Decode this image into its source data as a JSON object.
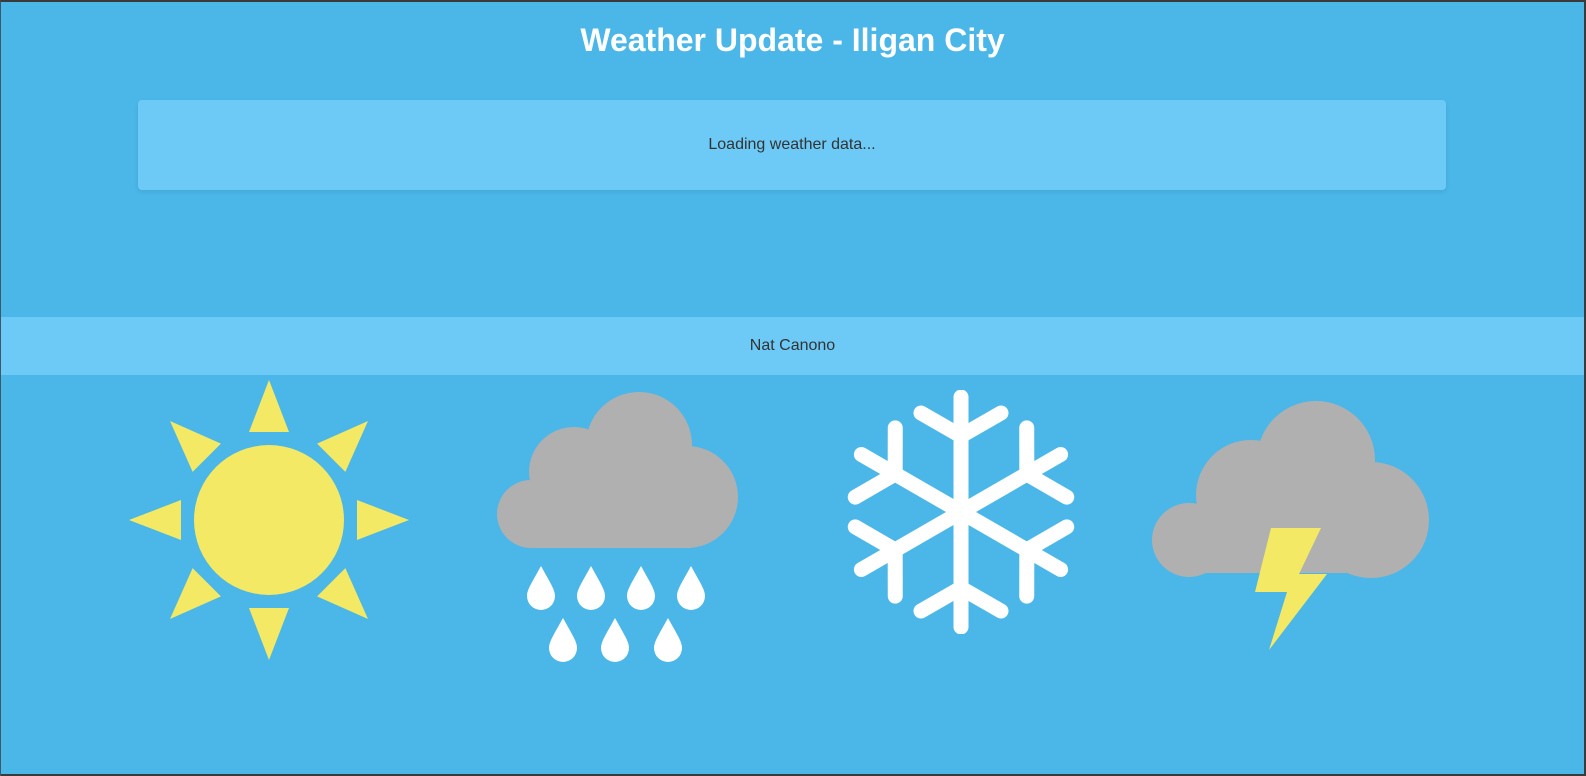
{
  "header": {
    "title": "Weather Update - Iligan City"
  },
  "weather_panel": {
    "status_text": "Loading weather data..."
  },
  "footer": {
    "author": "Nat Canono"
  },
  "icons": [
    "sun-icon",
    "rain-cloud-icon",
    "snowflake-icon",
    "thunderstorm-icon"
  ],
  "colors": {
    "background": "#4bb6e8",
    "panel": "#6dcaf6",
    "sun": "#f3e964",
    "cloud": "#b0b0b0",
    "white": "#ffffff"
  }
}
